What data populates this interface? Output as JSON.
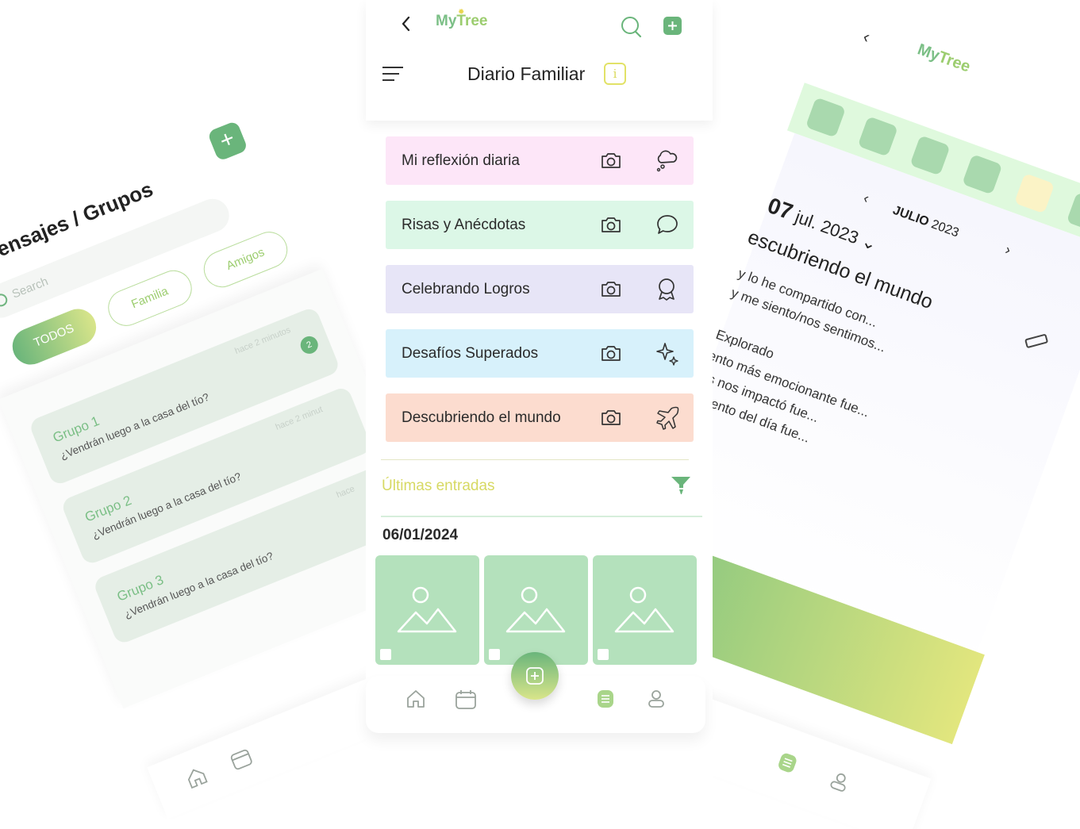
{
  "brand": {
    "logo_my": "My",
    "logo_tree": "Tree"
  },
  "colors": {
    "primary_green": "#6ab57b",
    "light_green": "#b4e1bc",
    "accent_yellow": "#d7d963",
    "cat_pink": "#fde6f8",
    "cat_mint": "#dcf7e7",
    "cat_lavender": "#e7e5f7",
    "cat_sky": "#d7f1fb",
    "cat_peach": "#fcdccf"
  },
  "center": {
    "title": "Diario Familiar",
    "info_glyph": "i",
    "categories": [
      {
        "label": "Mi reflexión diaria",
        "icon": "thought-cloud-icon"
      },
      {
        "label": "Risas y Anécdotas",
        "icon": "chat-bubble-icon"
      },
      {
        "label": "Celebrando Logros",
        "icon": "medal-icon"
      },
      {
        "label": "Desafíos Superados",
        "icon": "sparkles-icon"
      },
      {
        "label": "Descubriendo el mundo",
        "icon": "airplane-icon"
      }
    ],
    "recent_label": "Últimas entradas",
    "entry_date": "06/01/2024",
    "nav": [
      "home-icon",
      "calendar-icon",
      "add-icon",
      "diary-icon",
      "profile-icon"
    ]
  },
  "left": {
    "title": "Mensajes / Grupos",
    "search_placeholder": "Search",
    "chips": [
      "TODOS",
      "Familia",
      "Amigos"
    ],
    "groups": [
      {
        "name": "Grupo 1",
        "message": "¿Vendrán luego a la casa del tío?",
        "time": "hace 2 minutos",
        "badge": "2"
      },
      {
        "name": "Grupo 2",
        "message": "¿Vendrán luego a la casa del tío?",
        "time": "hace 2 minut",
        "badge": ""
      },
      {
        "name": "Grupo 3",
        "message": "¿Vendrán luego a la casa del tío?",
        "time": "hace",
        "badge": ""
      }
    ]
  },
  "right": {
    "month": "JULIO",
    "year": "2023",
    "day": "07",
    "date_rest": "jul. 2023",
    "entry_title": "escubriendo el mundo",
    "lines": [
      "y lo he compartido con...",
      "y me siento/nos sentimos...",
      "Explorado",
      "ento más emocionante fue...",
      "ás nos impactó fue...",
      "omento del día fue..."
    ]
  }
}
